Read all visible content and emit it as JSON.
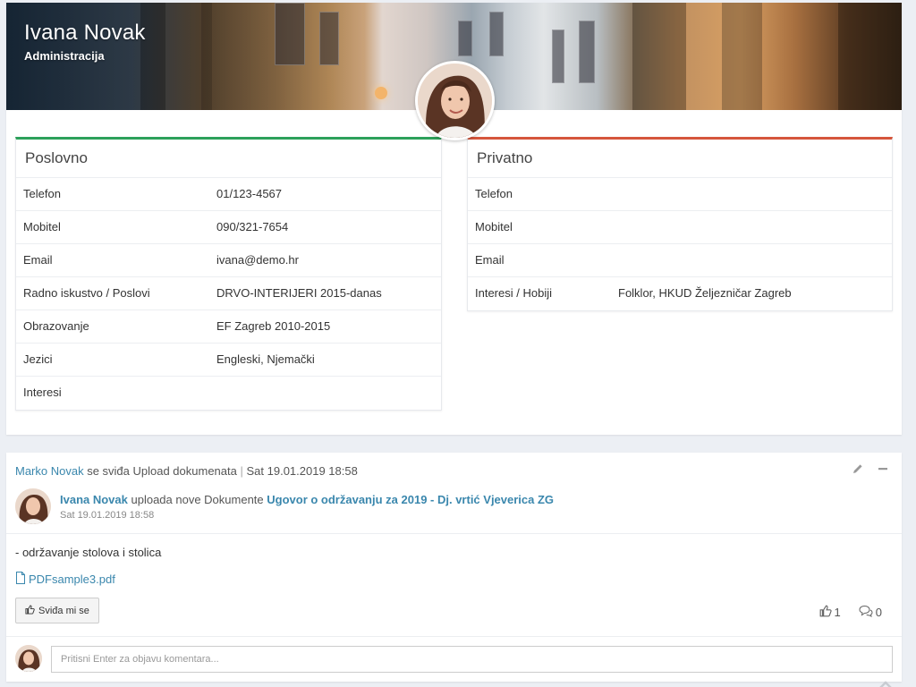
{
  "profile": {
    "name": "Ivana Novak",
    "department": "Administracija"
  },
  "business": {
    "title": "Poslovno",
    "rows": [
      {
        "label": "Telefon",
        "value": "01/123-4567"
      },
      {
        "label": "Mobitel",
        "value": "090/321-7654"
      },
      {
        "label": "Email",
        "value": "ivana@demo.hr"
      },
      {
        "label": "Radno iskustvo / Poslovi",
        "value": "DRVO-INTERIJERI 2015-danas"
      },
      {
        "label": "Obrazovanje",
        "value": "EF Zagreb 2010-2015"
      },
      {
        "label": "Jezici",
        "value": "Engleski, Njemački"
      },
      {
        "label": "Interesi",
        "value": ""
      }
    ]
  },
  "private": {
    "title": "Privatno",
    "rows": [
      {
        "label": "Telefon",
        "value": ""
      },
      {
        "label": "Mobitel",
        "value": ""
      },
      {
        "label": "Email",
        "value": ""
      },
      {
        "label": "Interesi / Hobiji",
        "value": "Folklor, HKUD Željezničar Zagreb"
      }
    ]
  },
  "activity": {
    "actor": "Marko Novak",
    "action": " se sviđa Upload dokumenata",
    "separator": "|",
    "timestamp": "Sat 19.01.2019 18:58",
    "post": {
      "author": "Ivana Novak",
      "verb": " uploada nove Dokumente ",
      "document": "Ugovor o održavanju za 2019 - Dj. vrtić Vjeverica ZG",
      "date": "Sat 19.01.2019 18:58",
      "text": "- održavanje stolova i stolica",
      "attachment": "PDFsample3.pdf"
    },
    "like_label": "Sviđa mi se",
    "likes": "1",
    "comments": "0",
    "comment_placeholder": "Pritisni Enter za objavu komentara..."
  },
  "colors": {
    "business_accent": "#2da05a",
    "private_accent": "#d5563c",
    "link": "#3a87ad"
  },
  "icons": [
    "pencil-icon",
    "minus-icon",
    "file-icon",
    "thumbs-up-icon",
    "comments-icon",
    "chevron-up-icon"
  ]
}
